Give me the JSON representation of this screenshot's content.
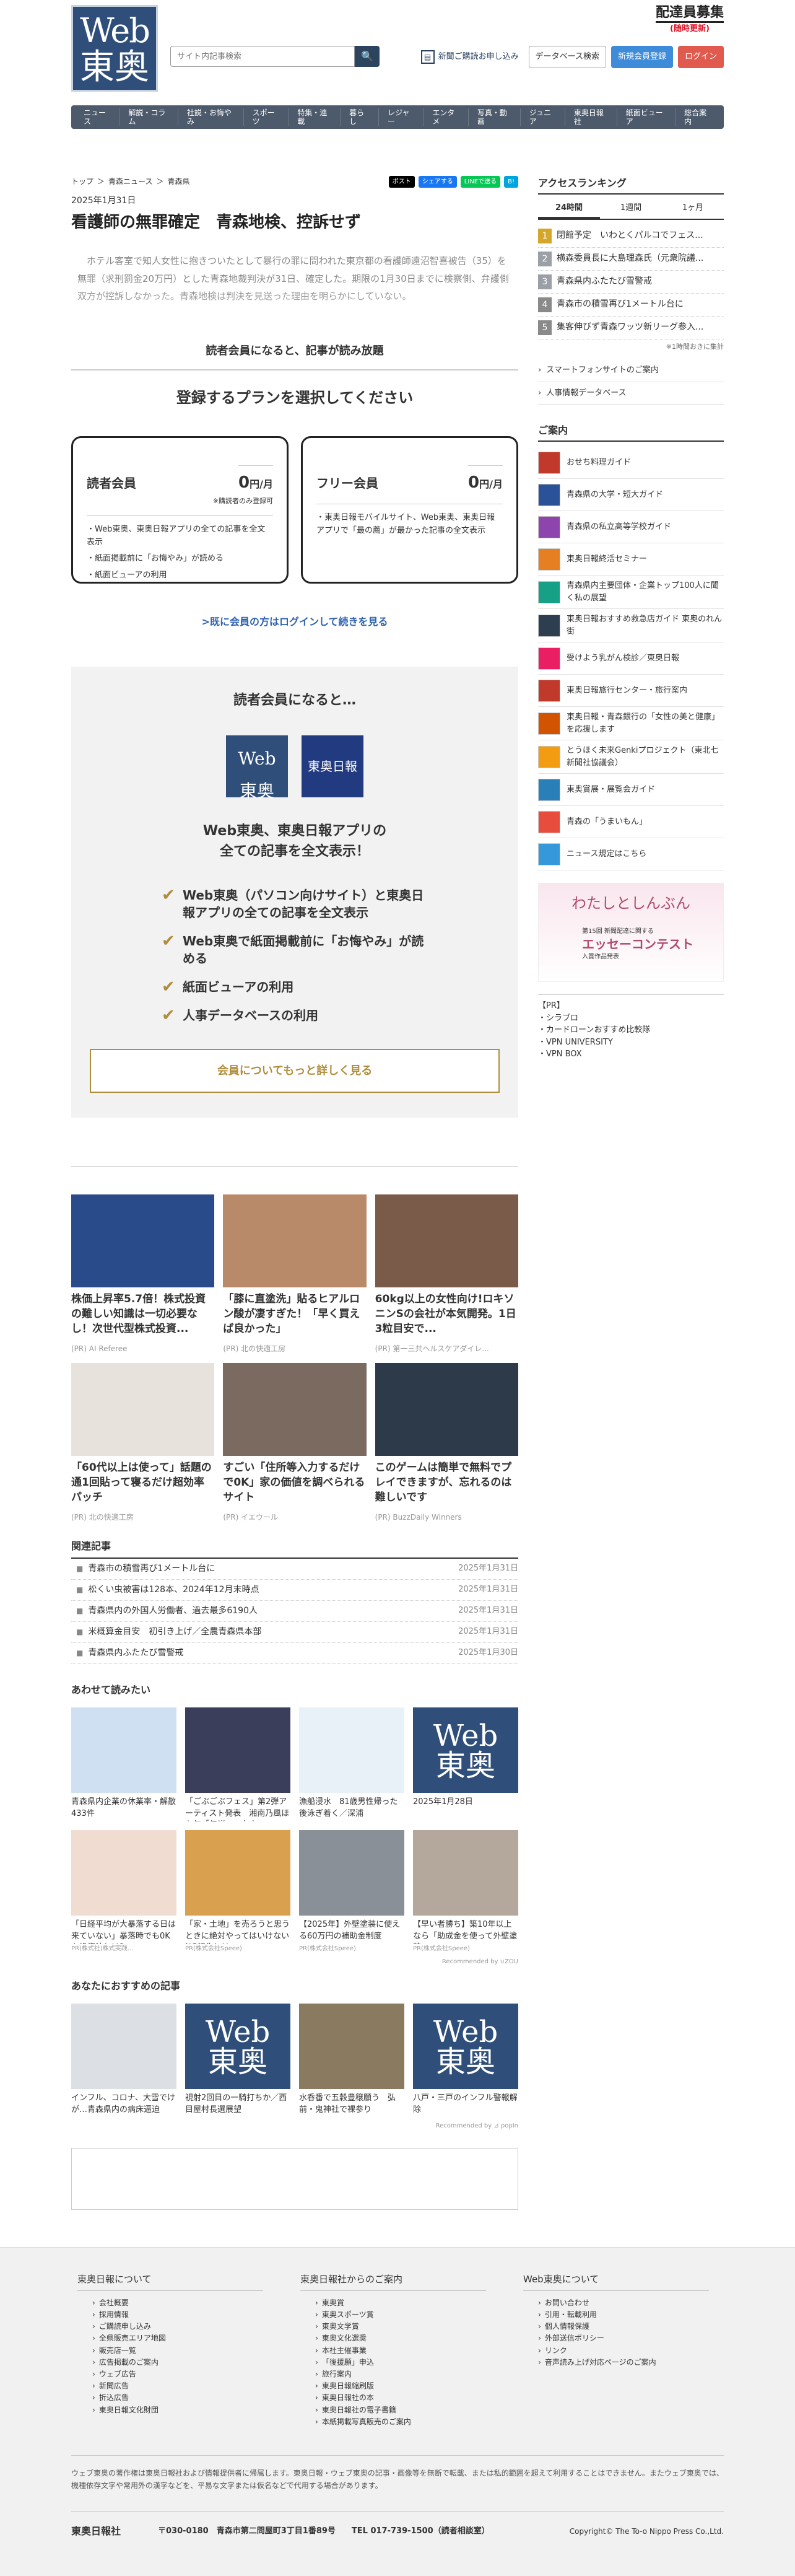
{
  "header": {
    "logo_line1": "Web",
    "logo_line2": "東奥",
    "search_placeholder": "サイト内記事検索",
    "recruit_title": "配達員募集",
    "recruit_sub": "(随時更新)",
    "paper_signup": "新聞ご購読お申し込み",
    "db_search": "データベース検索",
    "member_signup": "新規会員登録",
    "login": "ログイン"
  },
  "nav": [
    "ニュース",
    "解説・コラム",
    "社説・お悔やみ",
    "スポーツ",
    "特集・連載",
    "暮らし",
    "レジャー",
    "エンタメ",
    "写真・動画",
    "ジュニア",
    "東奥日報社",
    "紙面ビューア",
    "総合案内"
  ],
  "breadcrumb": [
    "トップ",
    "青森ニュース",
    "青森県"
  ],
  "share": [
    "ポスト",
    "シェアする",
    "LINEで送る",
    "B!"
  ],
  "article": {
    "date": "2025年1月31日",
    "title": "看護師の無罪確定　青森地検、控訴せず",
    "lead": "　ホテル客室で知人女性に抱きついたとして暴行の罪に問われた東京都の看護師遠沼智喜被告（35）を無罪（求刑罰金20万円）とした青森地裁判決が31日、確定した。期限の1月30日までに検察側、弁護側双方が控訴しなかった。青森地検は判決を見送った理由を明らかにしていない。",
    "members_only": "読者会員になると、記事が読み放題"
  },
  "plans": {
    "heading": "登録するプランを選択してください",
    "items": [
      {
        "name": "読者会員",
        "price": "0",
        "unit": "円/月",
        "note": "※購読者のみ登録可",
        "features": [
          "Web東奥、東奥日報アプリの全ての記事を全文表示",
          "紙面掲載前に「お悔やみ」が読める",
          "紙面ビューアの利用"
        ]
      },
      {
        "name": "フリー会員",
        "price": "0",
        "unit": "円/月",
        "note": "",
        "features": [
          "東奥日報モバイルサイト、Web東奥、東奥日報アプリで「最の薦」が最かった記事の全文表示"
        ]
      }
    ],
    "login_link": ">既に会員の方はログインして続きを見る"
  },
  "benefit": {
    "heading": "読者会員になると…",
    "logo_a_1": "Web",
    "logo_a_2": "東奥",
    "logo_b": "東奥日報",
    "headline": "Web東奥、東奥日報アプリの\n全ての記事を全文表示！",
    "items": [
      "Web東奥（パソコン向けサイト）と東奥日報アプリの全ての記事を全文表示",
      "Web東奥で紙面掲載前に「お悔やみ」が読める",
      "紙面ビューアの利用",
      "人事データベースの利用"
    ],
    "more": "会員についてもっと詳しく見る"
  },
  "ads": [
    {
      "title": "株価上昇率5.7倍！株式投資の難しい知識は一切必要なし！次世代型株式投資...",
      "source": "(PR) AI Referee",
      "color": "#2a4b8a"
    },
    {
      "title": "「膝に直塗洗」貼るヒアルロン酸が凄すぎた！「早く買えば良かった」",
      "source": "(PR) 北の快適工房",
      "color": "#b88a6a"
    },
    {
      "title": "60kg以上の女性向け!ロキソニンSの会社が本気開発。1日3粒目安で...",
      "source": "(PR) 第一三共ヘルスケアダイレ...",
      "color": "#7a5a48"
    },
    {
      "title": "「60代以上は使って」話題の通1回貼って寝るだけ超効率パッチ",
      "source": "(PR) 北の快適工房",
      "color": "#e7e2dc"
    },
    {
      "title": "すごい「住所等入力するだけで0K」家の価値を調べられるサイト",
      "source": "(PR) イエウール",
      "color": "#7a6a60"
    },
    {
      "title": "このゲームは簡単で無料でプレイできますが、忘れるのは難しいです",
      "source": "(PR) BuzzDaily Winners",
      "color": "#2d3a4a"
    }
  ],
  "related": {
    "heading": "関連記事",
    "items": [
      {
        "title": "青森市の積雪再び1メートル台に",
        "date": "2025年1月31日"
      },
      {
        "title": "松くい虫被害は128本、2024年12月末時点",
        "date": "2025年1月31日"
      },
      {
        "title": "青森県内の外国人労働者、過去最多6190人",
        "date": "2025年1月31日"
      },
      {
        "title": "米概算金目安　初引き上げ／全農青森県本部",
        "date": "2025年1月31日"
      },
      {
        "title": "青森県内ふたたび雪警戒",
        "date": "2025年1月30日"
      }
    ]
  },
  "also_read": {
    "heading": "あわせて読みたい",
    "items": [
      {
        "title": "青森県内企業の休業率・解散433件",
        "source": "",
        "color": "#cfe0f2"
      },
      {
        "title": "「ごぶごぶフェス」第2弾アーティスト発表　湘南乃風ほか年「伝説」...丸山...",
        "source": "",
        "color": "#3b3e5a"
      },
      {
        "title": "漁船浸水　81歳男性帰った後泳ぎ着く／深浦",
        "source": "",
        "color": "#e8f0f8"
      },
      {
        "title": "2025年1月28日",
        "source": "",
        "color": "#2f4f7a"
      },
      {
        "title": "「日経平均が大暴落する日は来ていない」暴落時でも0K な投資法とは？",
        "source": "PR(株式社)株式実践...",
        "color": "#f0dcd0"
      },
      {
        "title": "「家・土地」を売ろうと思うときに絶対やってはいけないNG行為とは",
        "source": "PR(株式会社Speee)",
        "color": "#d9a050"
      },
      {
        "title": "【2025年】外壁塗装に使える60万円の補助金制度",
        "source": "PR(株式会社Speee)",
        "color": "#8a9098"
      },
      {
        "title": "【早い者勝ち】築10年以上なら「助成金を使って外壁塗装」",
        "source": "PR(株式会社Speee)",
        "color": "#b4a89c"
      }
    ],
    "recommended_by": "Recommended by ∪ZOU"
  },
  "recommend": {
    "heading": "あなたにおすすめの記事",
    "items": [
      {
        "title": "インフル、コロナ、大雪でけが…青森県内の病床逼迫",
        "color": "#dcdfe3"
      },
      {
        "title": "視射2回目の一騎打ちか／西目屋村長選展望",
        "color": "#2f4f7a"
      },
      {
        "title": "水呑番で五穀豊穣願う　弘前・鬼神社で裸参り",
        "color": "#8a7a60"
      },
      {
        "title": "八戸・三戸のインフル警報解除",
        "color": "#2f4f7a"
      }
    ],
    "recommended_by": "Recommended by ⊿ popIn"
  },
  "sidebar": {
    "ranking_title": "アクセスランキング",
    "tabs": [
      "24時間",
      "1週間",
      "1ヶ月"
    ],
    "ranking": [
      "閉館予定　いわとくパルコでフェス...",
      "横森委員長に大島理森氏（元衆院議...",
      "青森県内ふたたび雪警戒",
      "青森市の積雪再び1メートル台に",
      "集客伸びず青森ワッツ新リーグ参入..."
    ],
    "ranking_note": "※1時間おきに集計",
    "links": [
      "スマートフォンサイトのご案内",
      "人事情報データベース"
    ],
    "guide_title": "ご案内",
    "guide": [
      {
        "label": "おせち料理ガイド",
        "color": "#c0392b"
      },
      {
        "label": "青森県の大学・短大ガイド",
        "color": "#2a5298"
      },
      {
        "label": "青森県の私立高等学校ガイド",
        "color": "#8e44ad"
      },
      {
        "label": "東奥日報終活セミナー",
        "color": "#e67e22"
      },
      {
        "label": "青森県内主要団体・企業トップ100人に聞く私の展望",
        "color": "#16a085"
      },
      {
        "label": "東奥日報おすすめ救急店ガイド 東奥のれん街",
        "color": "#2c3e50"
      },
      {
        "label": "受けよう乳がん検診／東奥日報",
        "color": "#e91e63"
      },
      {
        "label": "東奥日報旅行センター・旅行案内",
        "color": "#c0392b"
      },
      {
        "label": "東奥日報・青森銀行の「女性の美と健康」を応援します",
        "color": "#d35400"
      },
      {
        "label": "とうほく未来Genkiプロジェクト（東北七新聞社協議会）",
        "color": "#f39c12"
      },
      {
        "label": "東奥賞展・展覧会ガイド",
        "color": "#2980b9"
      },
      {
        "label": "青森の「うまいもん」",
        "color": "#e74c3c"
      },
      {
        "label": "ニュース規定はこちら",
        "color": "#3498db"
      }
    ],
    "banner_title": "わたしとしんぶん",
    "banner_sub": "第15回 新聞配達に関する",
    "banner_main": "エッセーコンテスト",
    "banner_sub2": "入賞作品発表",
    "pr_label": "【PR】",
    "pr": [
      "シラブロ",
      "カードローンおすすめ比較隊",
      "VPN UNIVERSITY",
      "VPN BOX"
    ]
  },
  "footer": {
    "cols": [
      {
        "title": "東奥日報について",
        "items": [
          "会社概要",
          "採用情報",
          "ご購読申し込み",
          "全県販売エリア地図",
          "販売店一覧",
          "広告掲載のご案内",
          "ウェブ広告",
          "新聞広告",
          "折込広告",
          "東奥日報文化財団"
        ]
      },
      {
        "title": "東奥日報社からのご案内",
        "items": [
          "東奥賞",
          "東奥スポーツ賞",
          "東奥文学賞",
          "東奥文化選奨",
          "本社主催事業",
          "「後援願」申込",
          "旅行案内",
          "東奥日報縮刷版",
          "東奥日報社の本",
          "東奥日報社の電子書籍",
          "本紙掲載写真販売のご案内"
        ]
      },
      {
        "title": "Web東奥について",
        "items": [
          "お問い合わせ",
          "引用・転載利用",
          "個人情報保護",
          "外部送信ポリシー",
          "リンク",
          "音声読み上げ対応ページのご案内"
        ]
      }
    ],
    "notice": "ウェブ東奥の著作権は東奥日報社および情報提供者に帰属します。東奥日報・ウェブ東奥の記事・画像等を無断で転載、または私的範囲を超えて利用することはできません。またウェブ東奥では、機種依存文字や常用外の漢字などを、平易な文字または仮名などで代用する場合があります。",
    "company": "東奥日報社",
    "address": "〒030-0180　青森市第二問屋町3丁目1番89号　　TEL 017-739-1500（読者相談室）",
    "copyright": "Copyright© The To-o Nippo Press Co.,Ltd."
  }
}
